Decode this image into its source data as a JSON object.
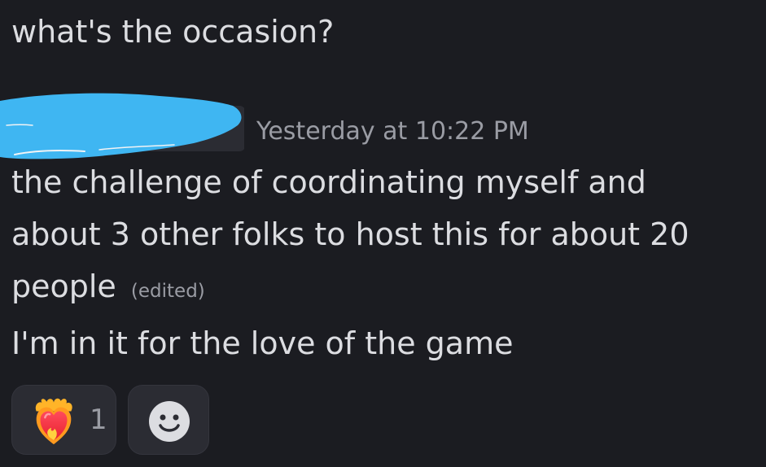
{
  "previous_message": {
    "text": "what's the occasion?"
  },
  "message": {
    "timestamp": "Yesterday at 10:22 PM",
    "lines": [
      "the challenge of coordinating myself and",
      "about 3 other folks to host this for about 20",
      "people"
    ],
    "edited_label": "(edited)",
    "followup": "I'm in it for the love of the game"
  },
  "reactions": [
    {
      "emoji": "heart-on-fire-icon",
      "count": "1"
    }
  ],
  "add_reaction": {
    "icon": "smiley-face-icon"
  },
  "colors": {
    "background": "#1b1c21",
    "text": "#dcdde1",
    "muted": "#9a9ca4",
    "pill": "#2b2c33",
    "redaction": "#3fb6f2"
  }
}
